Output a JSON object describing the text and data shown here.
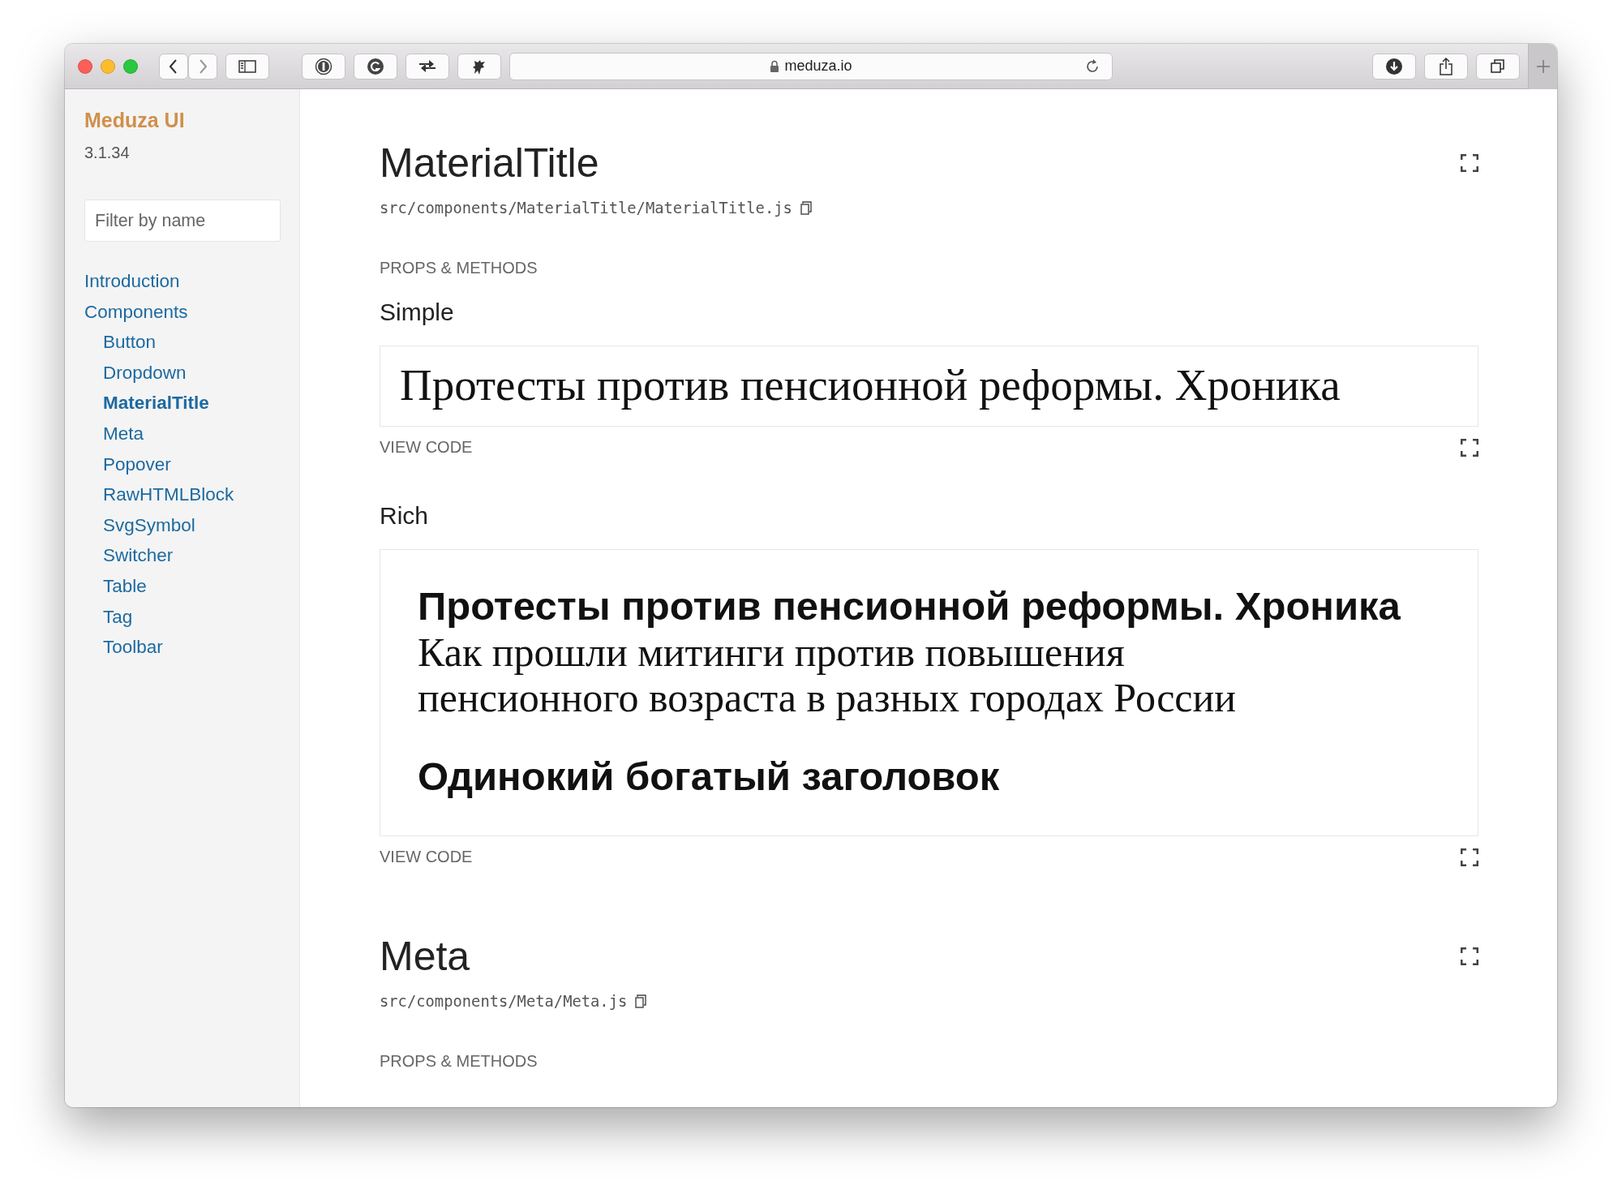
{
  "browser": {
    "url": "meduza.io"
  },
  "sidebar": {
    "title": "Meduza UI",
    "version": "3.1.34",
    "filter": {
      "placeholder": "Filter by name"
    },
    "items": [
      {
        "label": "Introduction",
        "selected": false
      },
      {
        "label": "Components",
        "selected": false,
        "children": [
          {
            "label": "Button",
            "selected": false
          },
          {
            "label": "Dropdown",
            "selected": false
          },
          {
            "label": "MaterialTitle",
            "selected": true
          },
          {
            "label": "Meta",
            "selected": false
          },
          {
            "label": "Popover",
            "selected": false
          },
          {
            "label": "RawHTMLBlock",
            "selected": false
          },
          {
            "label": "SvgSymbol",
            "selected": false
          },
          {
            "label": "Switcher",
            "selected": false
          },
          {
            "label": "Table",
            "selected": false
          },
          {
            "label": "Tag",
            "selected": false
          },
          {
            "label": "Toolbar",
            "selected": false
          }
        ]
      }
    ]
  },
  "sections": [
    {
      "title": "MaterialTitle",
      "path": "src/components/MaterialTitle/MaterialTitle.js",
      "props_label": "PROPS & METHODS",
      "examples": [
        {
          "title": "Simple",
          "view_code": "VIEW CODE",
          "lines": [
            {
              "kind": "serif",
              "text": "Протесты против пенсионной реформы. Хроника"
            }
          ]
        },
        {
          "title": "Rich",
          "view_code": "VIEW CODE",
          "lines": [
            {
              "kind": "bold",
              "text": "Протесты против пенсионной реформы. Хроника"
            },
            {
              "kind": "serif",
              "text": "Как прошли митинги против повышения пенсионного возраста в разных городах России"
            },
            {
              "kind": "bold-solo",
              "text": "Одинокий богатый заголовок"
            }
          ]
        }
      ]
    },
    {
      "title": "Meta",
      "path": "src/components/Meta/Meta.js",
      "props_label": "PROPS & METHODS"
    }
  ]
}
